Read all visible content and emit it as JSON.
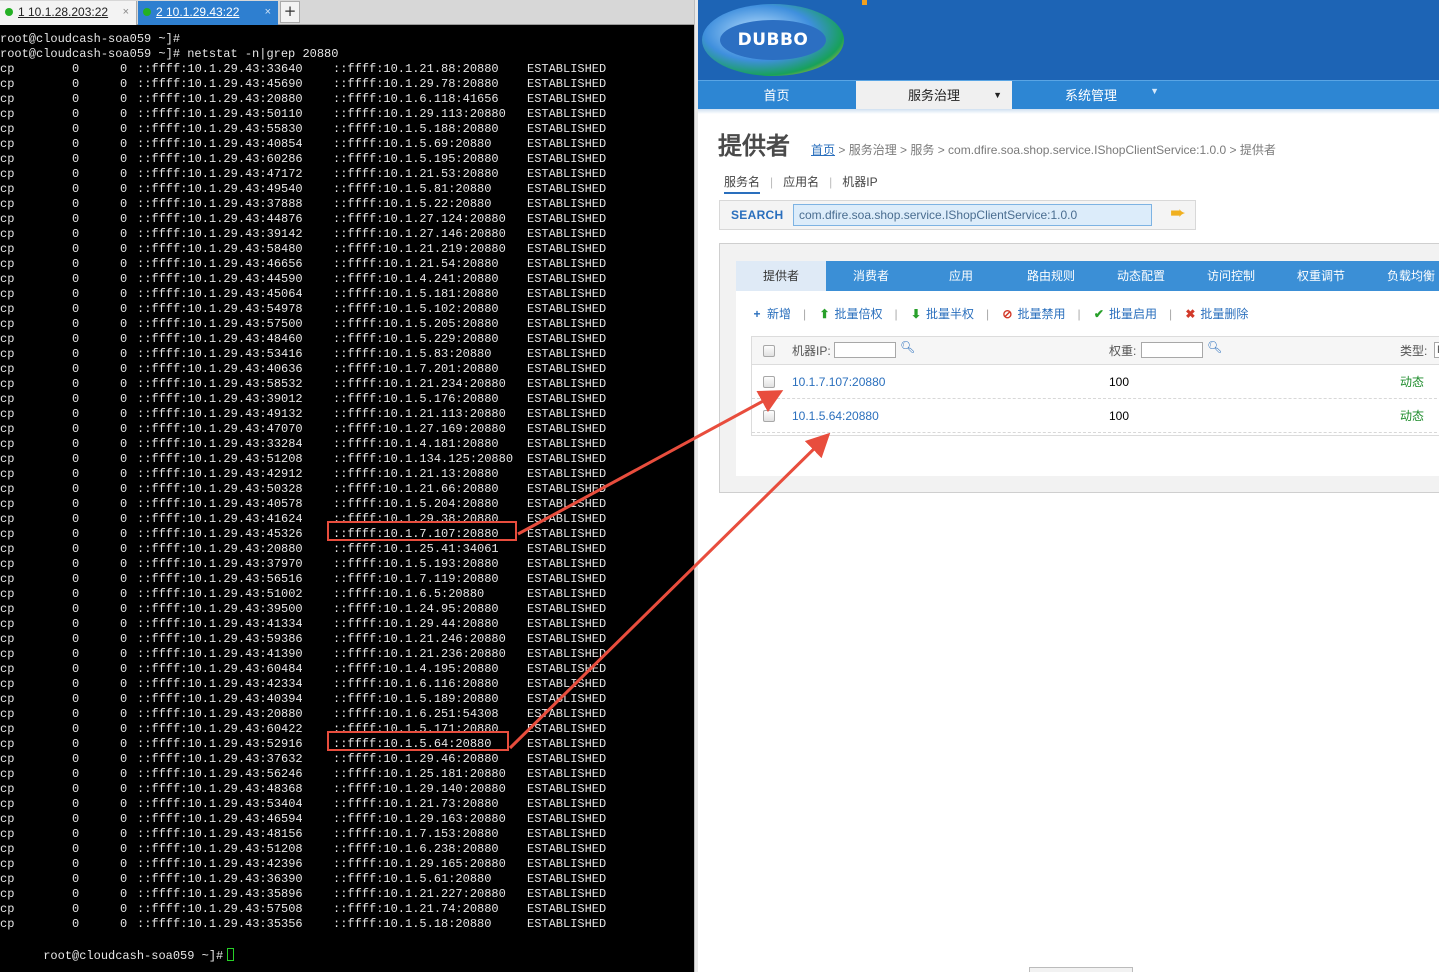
{
  "terminal": {
    "tabs": [
      {
        "label": "1 10.1.28.203:22",
        "close": "×"
      },
      {
        "label": "2 10.1.29.43:22",
        "close": "×"
      }
    ],
    "new_tab": "+",
    "prompt_1": "root@cloudcash-soa059 ~]#",
    "command_line": "root@cloudcash-soa059 ~]# netstat -n|grep 20880",
    "prompt_final": "root@cloudcash-soa059 ~]#",
    "rows": [
      [
        "cp",
        "0",
        "0",
        "::ffff:10.1.29.43:33640",
        "::ffff:10.1.21.88:20880",
        "ESTABLISHED"
      ],
      [
        "cp",
        "0",
        "0",
        "::ffff:10.1.29.43:45690",
        "::ffff:10.1.29.78:20880",
        "ESTABLISHED"
      ],
      [
        "cp",
        "0",
        "0",
        "::ffff:10.1.29.43:20880",
        "::ffff:10.1.6.118:41656",
        "ESTABLISHED"
      ],
      [
        "cp",
        "0",
        "0",
        "::ffff:10.1.29.43:50110",
        "::ffff:10.1.29.113:20880",
        "ESTABLISHED"
      ],
      [
        "cp",
        "0",
        "0",
        "::ffff:10.1.29.43:55830",
        "::ffff:10.1.5.188:20880",
        "ESTABLISHED"
      ],
      [
        "cp",
        "0",
        "0",
        "::ffff:10.1.29.43:40854",
        "::ffff:10.1.5.69:20880",
        "ESTABLISHED"
      ],
      [
        "cp",
        "0",
        "0",
        "::ffff:10.1.29.43:60286",
        "::ffff:10.1.5.195:20880",
        "ESTABLISHED"
      ],
      [
        "cp",
        "0",
        "0",
        "::ffff:10.1.29.43:47172",
        "::ffff:10.1.21.53:20880",
        "ESTABLISHED"
      ],
      [
        "cp",
        "0",
        "0",
        "::ffff:10.1.29.43:49540",
        "::ffff:10.1.5.81:20880",
        "ESTABLISHED"
      ],
      [
        "cp",
        "0",
        "0",
        "::ffff:10.1.29.43:37888",
        "::ffff:10.1.5.22:20880",
        "ESTABLISHED"
      ],
      [
        "cp",
        "0",
        "0",
        "::ffff:10.1.29.43:44876",
        "::ffff:10.1.27.124:20880",
        "ESTABLISHED"
      ],
      [
        "cp",
        "0",
        "0",
        "::ffff:10.1.29.43:39142",
        "::ffff:10.1.27.146:20880",
        "ESTABLISHED"
      ],
      [
        "cp",
        "0",
        "0",
        "::ffff:10.1.29.43:58480",
        "::ffff:10.1.21.219:20880",
        "ESTABLISHED"
      ],
      [
        "cp",
        "0",
        "0",
        "::ffff:10.1.29.43:46656",
        "::ffff:10.1.21.54:20880",
        "ESTABLISHED"
      ],
      [
        "cp",
        "0",
        "0",
        "::ffff:10.1.29.43:44590",
        "::ffff:10.1.4.241:20880",
        "ESTABLISHED"
      ],
      [
        "cp",
        "0",
        "0",
        "::ffff:10.1.29.43:45064",
        "::ffff:10.1.5.181:20880",
        "ESTABLISHED"
      ],
      [
        "cp",
        "0",
        "0",
        "::ffff:10.1.29.43:54978",
        "::ffff:10.1.5.102:20880",
        "ESTABLISHED"
      ],
      [
        "cp",
        "0",
        "0",
        "::ffff:10.1.29.43:57500",
        "::ffff:10.1.5.205:20880",
        "ESTABLISHED"
      ],
      [
        "cp",
        "0",
        "0",
        "::ffff:10.1.29.43:48460",
        "::ffff:10.1.5.229:20880",
        "ESTABLISHED"
      ],
      [
        "cp",
        "0",
        "0",
        "::ffff:10.1.29.43:53416",
        "::ffff:10.1.5.83:20880",
        "ESTABLISHED"
      ],
      [
        "cp",
        "0",
        "0",
        "::ffff:10.1.29.43:40636",
        "::ffff:10.1.7.201:20880",
        "ESTABLISHED"
      ],
      [
        "cp",
        "0",
        "0",
        "::ffff:10.1.29.43:58532",
        "::ffff:10.1.21.234:20880",
        "ESTABLISHED"
      ],
      [
        "cp",
        "0",
        "0",
        "::ffff:10.1.29.43:39012",
        "::ffff:10.1.5.176:20880",
        "ESTABLISHED"
      ],
      [
        "cp",
        "0",
        "0",
        "::ffff:10.1.29.43:49132",
        "::ffff:10.1.21.113:20880",
        "ESTABLISHED"
      ],
      [
        "cp",
        "0",
        "0",
        "::ffff:10.1.29.43:47070",
        "::ffff:10.1.27.169:20880",
        "ESTABLISHED"
      ],
      [
        "cp",
        "0",
        "0",
        "::ffff:10.1.29.43:33284",
        "::ffff:10.1.4.181:20880",
        "ESTABLISHED"
      ],
      [
        "cp",
        "0",
        "0",
        "::ffff:10.1.29.43:51208",
        "::ffff:10.1.134.125:20880",
        "ESTABLISHED"
      ],
      [
        "cp",
        "0",
        "0",
        "::ffff:10.1.29.43:42912",
        "::ffff:10.1.21.13:20880",
        "ESTABLISHED"
      ],
      [
        "cp",
        "0",
        "0",
        "::ffff:10.1.29.43:50328",
        "::ffff:10.1.21.66:20880",
        "ESTABLISHED"
      ],
      [
        "cp",
        "0",
        "0",
        "::ffff:10.1.29.43:40578",
        "::ffff:10.1.5.204:20880",
        "ESTABLISHED"
      ],
      [
        "cp",
        "0",
        "0",
        "::ffff:10.1.29.43:41624",
        "::ffff:10.1.29.38:20880",
        "ESTABLISHED"
      ],
      [
        "cp",
        "0",
        "0",
        "::ffff:10.1.29.43:45326",
        "::ffff:10.1.7.107:20880",
        "ESTABLISHED"
      ],
      [
        "cp",
        "0",
        "0",
        "::ffff:10.1.29.43:20880",
        "::ffff:10.1.25.41:34061",
        "ESTABLISHED"
      ],
      [
        "cp",
        "0",
        "0",
        "::ffff:10.1.29.43:37970",
        "::ffff:10.1.5.193:20880",
        "ESTABLISHED"
      ],
      [
        "cp",
        "0",
        "0",
        "::ffff:10.1.29.43:56516",
        "::ffff:10.1.7.119:20880",
        "ESTABLISHED"
      ],
      [
        "cp",
        "0",
        "0",
        "::ffff:10.1.29.43:51002",
        "::ffff:10.1.6.5:20880",
        "ESTABLISHED"
      ],
      [
        "cp",
        "0",
        "0",
        "::ffff:10.1.29.43:39500",
        "::ffff:10.1.24.95:20880",
        "ESTABLISHED"
      ],
      [
        "cp",
        "0",
        "0",
        "::ffff:10.1.29.43:41334",
        "::ffff:10.1.29.44:20880",
        "ESTABLISHED"
      ],
      [
        "cp",
        "0",
        "0",
        "::ffff:10.1.29.43:59386",
        "::ffff:10.1.21.246:20880",
        "ESTABLISHED"
      ],
      [
        "cp",
        "0",
        "0",
        "::ffff:10.1.29.43:41390",
        "::ffff:10.1.21.236:20880",
        "ESTABLISHED"
      ],
      [
        "cp",
        "0",
        "0",
        "::ffff:10.1.29.43:60484",
        "::ffff:10.1.4.195:20880",
        "ESTABLISHED"
      ],
      [
        "cp",
        "0",
        "0",
        "::ffff:10.1.29.43:42334",
        "::ffff:10.1.6.116:20880",
        "ESTABLISHED"
      ],
      [
        "cp",
        "0",
        "0",
        "::ffff:10.1.29.43:40394",
        "::ffff:10.1.5.189:20880",
        "ESTABLISHED"
      ],
      [
        "cp",
        "0",
        "0",
        "::ffff:10.1.29.43:20880",
        "::ffff:10.1.6.251:54308",
        "ESTABLISHED"
      ],
      [
        "cp",
        "0",
        "0",
        "::ffff:10.1.29.43:60422",
        "::ffff:10.1.5.171:20880",
        "ESTABLISHED"
      ],
      [
        "cp",
        "0",
        "0",
        "::ffff:10.1.29.43:52916",
        "::ffff:10.1.5.64:20880",
        "ESTABLISHED"
      ],
      [
        "cp",
        "0",
        "0",
        "::ffff:10.1.29.43:37632",
        "::ffff:10.1.29.46:20880",
        "ESTABLISHED"
      ],
      [
        "cp",
        "0",
        "0",
        "::ffff:10.1.29.43:56246",
        "::ffff:10.1.25.181:20880",
        "ESTABLISHED"
      ],
      [
        "cp",
        "0",
        "0",
        "::ffff:10.1.29.43:48368",
        "::ffff:10.1.29.140:20880",
        "ESTABLISHED"
      ],
      [
        "cp",
        "0",
        "0",
        "::ffff:10.1.29.43:53404",
        "::ffff:10.1.21.73:20880",
        "ESTABLISHED"
      ],
      [
        "cp",
        "0",
        "0",
        "::ffff:10.1.29.43:46594",
        "::ffff:10.1.29.163:20880",
        "ESTABLISHED"
      ],
      [
        "cp",
        "0",
        "0",
        "::ffff:10.1.29.43:48156",
        "::ffff:10.1.7.153:20880",
        "ESTABLISHED"
      ],
      [
        "cp",
        "0",
        "0",
        "::ffff:10.1.29.43:51208",
        "::ffff:10.1.6.238:20880",
        "ESTABLISHED"
      ],
      [
        "cp",
        "0",
        "0",
        "::ffff:10.1.29.43:42396",
        "::ffff:10.1.29.165:20880",
        "ESTABLISHED"
      ],
      [
        "cp",
        "0",
        "0",
        "::ffff:10.1.29.43:36390",
        "::ffff:10.1.5.61:20880",
        "ESTABLISHED"
      ],
      [
        "cp",
        "0",
        "0",
        "::ffff:10.1.29.43:35896",
        "::ffff:10.1.21.227:20880",
        "ESTABLISHED"
      ],
      [
        "cp",
        "0",
        "0",
        "::ffff:10.1.29.43:57508",
        "::ffff:10.1.21.74:20880",
        "ESTABLISHED"
      ],
      [
        "cp",
        "0",
        "0",
        "::ffff:10.1.29.43:35356",
        "::ffff:10.1.5.18:20880",
        "ESTABLISHED"
      ]
    ],
    "highlighted_rows": [
      31,
      45
    ]
  },
  "dubbo": {
    "logo_text": "DUBBO",
    "nav": {
      "home": "首页",
      "governance": "服务治理",
      "system": "系统管理"
    },
    "page_title": "提供者",
    "breadcrumb": {
      "home": "首页",
      "rest": " > 服务治理 > 服务 > com.dfire.soa.shop.service.IShopClientService:1.0.0 > 提供者"
    },
    "search_tabs": [
      "服务名",
      "应用名",
      "机器IP"
    ],
    "search": {
      "label": "SEARCH",
      "value": "com.dfire.soa.shop.service.IShopClientService:1.0.0"
    },
    "panel_tabs": [
      "提供者",
      "消费者",
      "应用",
      "路由规则",
      "动态配置",
      "访问控制",
      "权重调节",
      "负载均衡"
    ],
    "actions": [
      "新增",
      "批量倍权",
      "批量半权",
      "批量禁用",
      "批量启用",
      "批量删除"
    ],
    "table": {
      "headers": {
        "ip": "机器IP:",
        "weight": "权重:",
        "type": "类型:"
      },
      "rows": [
        {
          "ip": "10.1.7.107:20880",
          "weight": "100",
          "type": "动态"
        },
        {
          "ip": "10.1.5.64:20880",
          "weight": "100",
          "type": "动态"
        }
      ]
    }
  },
  "colors": {
    "annotation": "#e84d3d",
    "nav_blue": "#2d86d3",
    "link_blue": "#2a6fbd",
    "dynamic_green": "#1e8c2c"
  }
}
